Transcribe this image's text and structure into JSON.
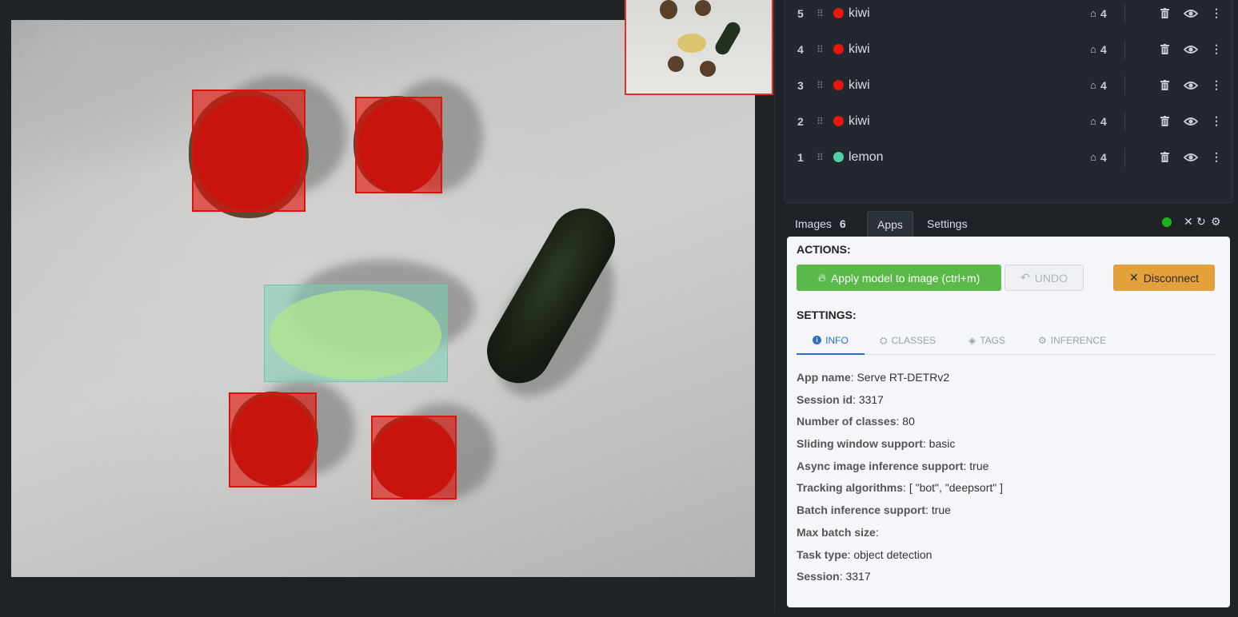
{
  "objects": [
    {
      "num": "5",
      "name": "kiwi",
      "tags": "4",
      "color": "#e8160c"
    },
    {
      "num": "4",
      "name": "kiwi",
      "tags": "4",
      "color": "#e8160c"
    },
    {
      "num": "3",
      "name": "kiwi",
      "tags": "4",
      "color": "#e8160c"
    },
    {
      "num": "2",
      "name": "kiwi",
      "tags": "4",
      "color": "#e8160c"
    },
    {
      "num": "1",
      "name": "lemon",
      "tags": "4",
      "color": "#4fd1a5"
    }
  ],
  "tabs": {
    "images_label": "Images",
    "images_count": "6",
    "apps_label": "Apps",
    "settings_label": "Settings",
    "status_color": "#1bb31b"
  },
  "apps": {
    "actions_title": "ACTIONS:",
    "apply_label": "Apply model to image (ctrl+m)",
    "undo_label": "UNDO",
    "disconnect_label": "Disconnect",
    "settings_title": "SETTINGS:",
    "subtabs": [
      "INFO",
      "CLASSES",
      "TAGS",
      "INFERENCE"
    ],
    "info": [
      {
        "key": "App name",
        "value": "Serve RT-DETRv2"
      },
      {
        "key": "Session id",
        "value": "3317"
      },
      {
        "key": "Number of classes",
        "value": "80"
      },
      {
        "key": "Sliding window support",
        "value": "basic"
      },
      {
        "key": "Async image inference support",
        "value": "true"
      },
      {
        "key": "Tracking algorithms",
        "value": "[ \"bot\", \"deepsort\" ]"
      },
      {
        "key": "Batch inference support",
        "value": "true"
      },
      {
        "key": "Max batch size",
        "value": ""
      },
      {
        "key": "Task type",
        "value": "object detection"
      },
      {
        "key": "Session",
        "value": "3317"
      }
    ]
  },
  "colors": {
    "kiwi": "#e8160c",
    "lemon": "#4fd1a5",
    "apply": "#5ab948",
    "disconnect": "#e3a03b",
    "accent": "#2f6fbf"
  },
  "icons": [
    "drag-handle-icon",
    "tag-icon",
    "trash-icon",
    "eye-icon",
    "kebab-icon",
    "close-icon",
    "refresh-icon",
    "gear-icon",
    "magic-icon",
    "undo-icon",
    "info-icon",
    "classes-icon",
    "tags-icon",
    "inference-icon"
  ]
}
